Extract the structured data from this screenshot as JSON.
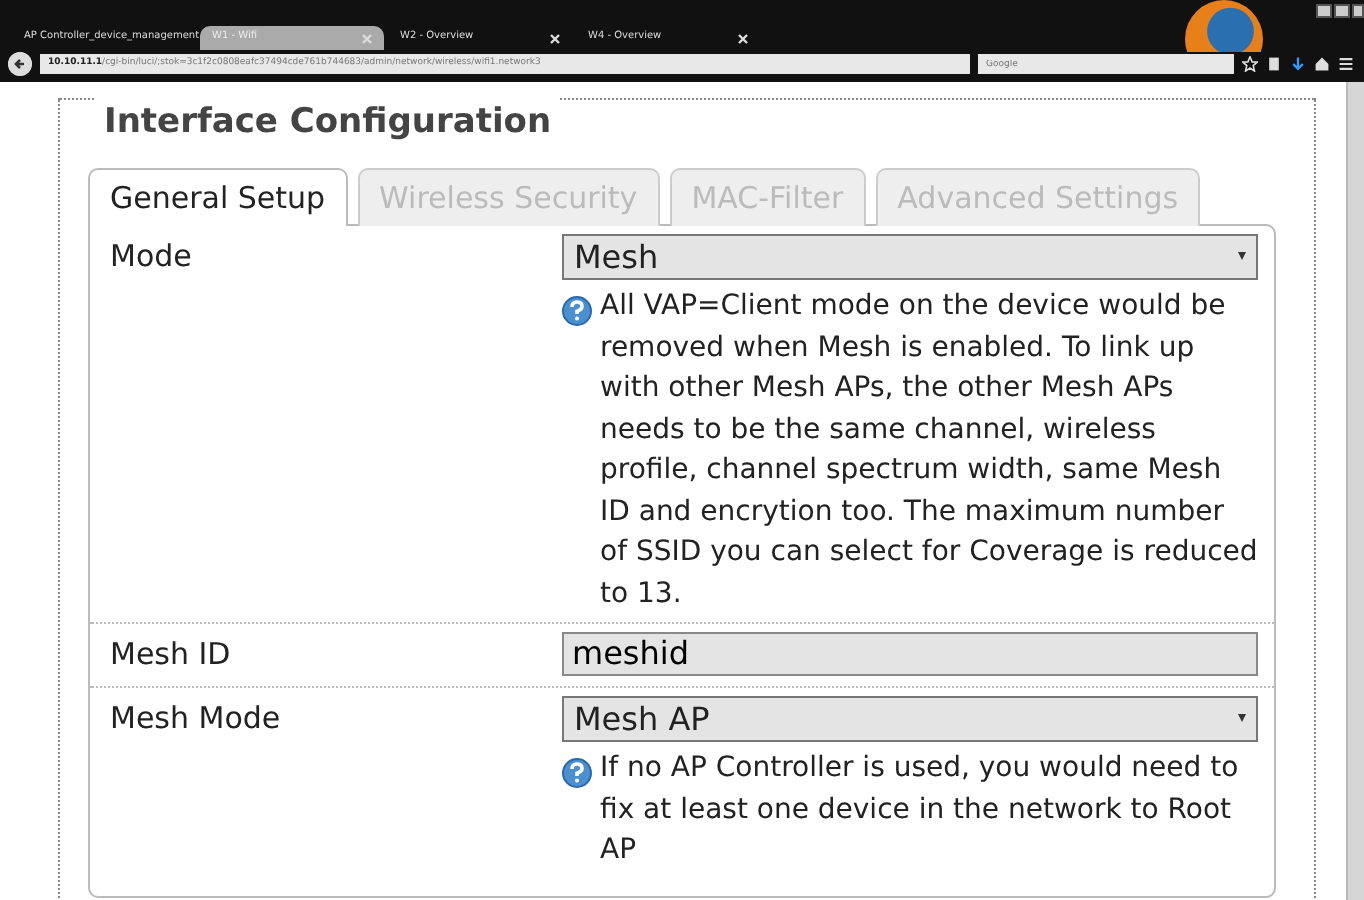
{
  "browser": {
    "tabs": [
      {
        "label": "AP Controller_device_management",
        "selected": false
      },
      {
        "label": "W1 - Wifi",
        "selected": true
      },
      {
        "label": "W2 - Overview",
        "selected": false
      },
      {
        "label": "W4 - Overview",
        "selected": false
      }
    ],
    "address": {
      "host": "10.10.11.1",
      "path": "/cgi-bin/luci/;stok=3c1f2c0808eafc37494cde761b744683/admin/network/wireless/wifi1.network3"
    },
    "search": {
      "placeholder": "Google"
    }
  },
  "section": {
    "title": "Interface Configuration",
    "tabs": [
      {
        "label": "General Setup",
        "selected": true
      },
      {
        "label": "Wireless Security",
        "selected": false
      },
      {
        "label": "MAC-Filter",
        "selected": false
      },
      {
        "label": "Advanced Settings",
        "selected": false
      }
    ],
    "fields": [
      {
        "kind": "select",
        "label": "Mode",
        "value": "Mesh",
        "help": "All VAP=Client mode on the device would be removed when Mesh is enabled. To link up with other Mesh APs, the other Mesh APs needs to be the same channel, wireless profile, channel spectrum width, same Mesh ID and encrytion too. The maximum number of SSID you can select for Coverage is reduced to 13."
      },
      {
        "kind": "text",
        "label": "Mesh ID",
        "value": "meshid"
      },
      {
        "kind": "select",
        "label": "Mesh Mode",
        "value": "Mesh AP",
        "help": "If no AP Controller is used, you would need to fix at least one device in the network to Root AP"
      }
    ]
  }
}
